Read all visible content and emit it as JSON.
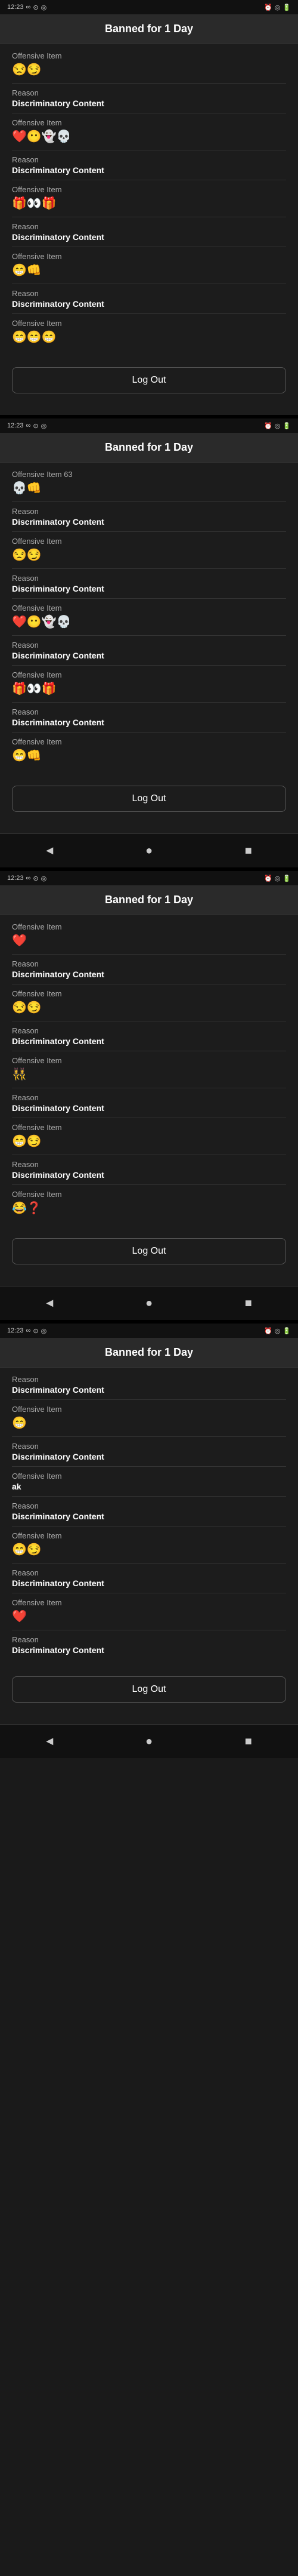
{
  "screens": [
    {
      "id": "screen1",
      "title": "Banned for 1 Day",
      "status_time": "12:23",
      "items": [
        {
          "label": "Offensive Item",
          "value": "😒😏",
          "is_emoji": true
        },
        {
          "label": "Reason",
          "value": "Discriminatory Content",
          "is_emoji": false
        },
        {
          "label": "Offensive Item",
          "value": "❤️😶👻💀",
          "is_emoji": true
        },
        {
          "label": "Reason",
          "value": "Discriminatory Content",
          "is_emoji": false
        },
        {
          "label": "Offensive Item",
          "value": "🎁👀🎁",
          "is_emoji": true
        },
        {
          "label": "Reason",
          "value": "Discriminatory Content",
          "is_emoji": false
        },
        {
          "label": "Offensive Item",
          "value": "😁👊",
          "is_emoji": true
        },
        {
          "label": "Reason",
          "value": "Discriminatory Content",
          "is_emoji": false
        },
        {
          "label": "Offensive Item",
          "value": "😁😁😁",
          "is_emoji": true
        }
      ],
      "logout_label": "Log Out",
      "has_nav": false
    },
    {
      "id": "screen2",
      "title": "Banned for 1 Day",
      "status_time": "12:23",
      "items": [
        {
          "label": "Offensive Item 63",
          "value": "💀👊",
          "is_emoji": true
        },
        {
          "label": "Reason",
          "value": "Discriminatory Content",
          "is_emoji": false
        },
        {
          "label": "Offensive Item",
          "value": "😒😏",
          "is_emoji": true
        },
        {
          "label": "Reason",
          "value": "Discriminatory Content",
          "is_emoji": false
        },
        {
          "label": "Offensive Item",
          "value": "❤️😶👻💀",
          "is_emoji": true
        },
        {
          "label": "Reason",
          "value": "Discriminatory Content",
          "is_emoji": false
        },
        {
          "label": "Offensive Item",
          "value": "🎁👀🎁",
          "is_emoji": true
        },
        {
          "label": "Reason",
          "value": "Discriminatory Content",
          "is_emoji": false
        },
        {
          "label": "Offensive Item",
          "value": "😁👊",
          "is_emoji": true
        }
      ],
      "logout_label": "Log Out",
      "has_nav": true
    },
    {
      "id": "screen3",
      "title": "Banned for 1 Day",
      "status_time": "12:23",
      "items": [
        {
          "label": "Offensive Item",
          "value": "❤️",
          "is_emoji": true
        },
        {
          "label": "Reason",
          "value": "Discriminatory Content",
          "is_emoji": false
        },
        {
          "label": "Offensive Item",
          "value": "😒😏",
          "is_emoji": true
        },
        {
          "label": "Reason",
          "value": "Discriminatory Content",
          "is_emoji": false
        },
        {
          "label": "Offensive Item",
          "value": "👯‍♀️",
          "is_emoji": true
        },
        {
          "label": "Reason",
          "value": "Discriminatory Content",
          "is_emoji": false
        },
        {
          "label": "Offensive Item",
          "value": "😁😏",
          "is_emoji": true
        },
        {
          "label": "Reason",
          "value": "Discriminatory Content",
          "is_emoji": false
        },
        {
          "label": "Offensive Item",
          "value": "😂❓",
          "is_emoji": true
        }
      ],
      "logout_label": "Log Out",
      "has_nav": true
    },
    {
      "id": "screen4",
      "title": "Banned for 1 Day",
      "status_time": "12:23",
      "items": [
        {
          "label": "Reason",
          "value": "Discriminatory Content",
          "is_emoji": false
        },
        {
          "label": "Offensive Item",
          "value": "😁",
          "is_emoji": true
        },
        {
          "label": "Reason",
          "value": "Discriminatory Content",
          "is_emoji": false
        },
        {
          "label": "Offensive Item",
          "value": "ak",
          "is_emoji": false
        },
        {
          "label": "Reason",
          "value": "Discriminatory Content",
          "is_emoji": false
        },
        {
          "label": "Offensive Item",
          "value": "😁😏",
          "is_emoji": true
        },
        {
          "label": "Reason",
          "value": "Discriminatory Content",
          "is_emoji": false
        },
        {
          "label": "Offensive Item",
          "value": "❤️",
          "is_emoji": true
        },
        {
          "label": "Reason",
          "value": "Discriminatory Content",
          "is_emoji": false
        }
      ],
      "logout_label": "Log Out",
      "has_nav": true
    }
  ],
  "nav": {
    "back": "◄",
    "home": "●",
    "recent": "■"
  }
}
